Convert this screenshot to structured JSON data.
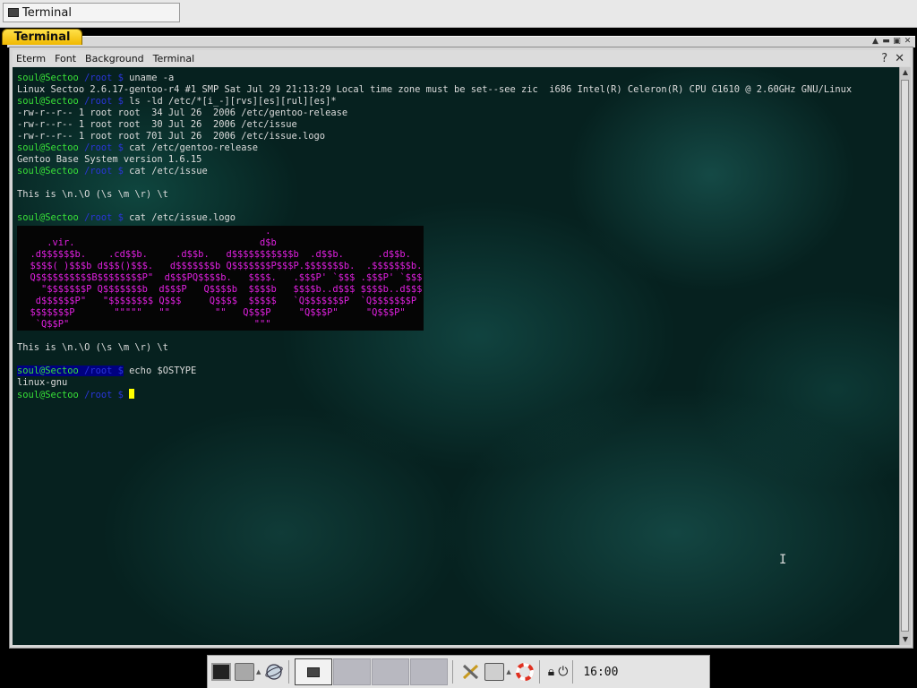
{
  "taskbar": {
    "task_title": "Terminal"
  },
  "window": {
    "tab_title": "Terminal",
    "menu": [
      "Eterm",
      "Font",
      "Background",
      "Terminal"
    ],
    "help_glyph": "?",
    "close_glyph": "✕"
  },
  "terminal": {
    "user": "soul@Sectoo",
    "path": "/root",
    "prompt_symbol": "$",
    "lines": [
      {
        "kind": "cmd",
        "text": "uname -a"
      },
      {
        "kind": "out",
        "text": "Linux Sectoo 2.6.17-gentoo-r4 #1 SMP Sat Jul 29 21:13:29 Local time zone must be set--see zic  i686 Intel(R) Celeron(R) CPU G1610 @ 2.60GHz GNU/Linux"
      },
      {
        "kind": "cmd",
        "text": "ls -ld /etc/*[i_-][rvs][es][rul][es]*"
      },
      {
        "kind": "out",
        "text": "-rw-r--r-- 1 root root  34 Jul 26  2006 /etc/gentoo-release"
      },
      {
        "kind": "out",
        "text": "-rw-r--r-- 1 root root  30 Jul 26  2006 /etc/issue"
      },
      {
        "kind": "out",
        "text": "-rw-r--r-- 1 root root 701 Jul 26  2006 /etc/issue.logo"
      },
      {
        "kind": "cmd",
        "text": "cat /etc/gentoo-release"
      },
      {
        "kind": "out",
        "text": "Gentoo Base System version 1.6.15"
      },
      {
        "kind": "cmd",
        "text": "cat /etc/issue"
      },
      {
        "kind": "out",
        "text": ""
      },
      {
        "kind": "out",
        "text": "This is \\n.\\O (\\s \\m \\r) \\t"
      },
      {
        "kind": "out",
        "text": ""
      },
      {
        "kind": "cmd",
        "text": "cat /etc/issue.logo"
      }
    ],
    "logo": [
      "                                            .",
      "     .vir.                                 d$b",
      "  .d$$$$$$b.    .cd$$b.     .d$$b.   d$$$$$$$$$$$b  .d$$b.      .d$$b.",
      "  $$$$( )$$$b d$$$()$$$.   d$$$$$$$b Q$$$$$$$P$$$P.$$$$$$$b.  .$$$$$$$b.",
      "  Q$$$$$$$$$$B$$$$$$$$P\"  d$$$PQ$$$$b.   $$$$.   .$$$P' `$$$ .$$$P' `$$$",
      "    \"$$$$$$$P Q$$$$$$$b  d$$$P   Q$$$$b  $$$$b   $$$$b..d$$$ $$$$b..d$$$",
      "   d$$$$$$P\"   \"$$$$$$$$ Q$$$     Q$$$$  $$$$$   `Q$$$$$$$P  `Q$$$$$$$P",
      "  $$$$$$$P       \"\"\"\"\"   \"\"        \"\"   Q$$$P     \"Q$$$P\"     \"Q$$$P\"",
      "   `Q$$P\"                                 \"\"\""
    ],
    "after_logo": [
      {
        "kind": "out",
        "text": ""
      },
      {
        "kind": "out",
        "text": "This is \\n.\\O (\\s \\m \\r) \\t"
      },
      {
        "kind": "out",
        "text": ""
      },
      {
        "kind": "cmd_hl",
        "text": "echo $OSTYPE"
      },
      {
        "kind": "out",
        "text": "linux-gnu"
      },
      {
        "kind": "cmd_cursor",
        "text": ""
      }
    ]
  },
  "panel": {
    "clock": "16:00"
  }
}
